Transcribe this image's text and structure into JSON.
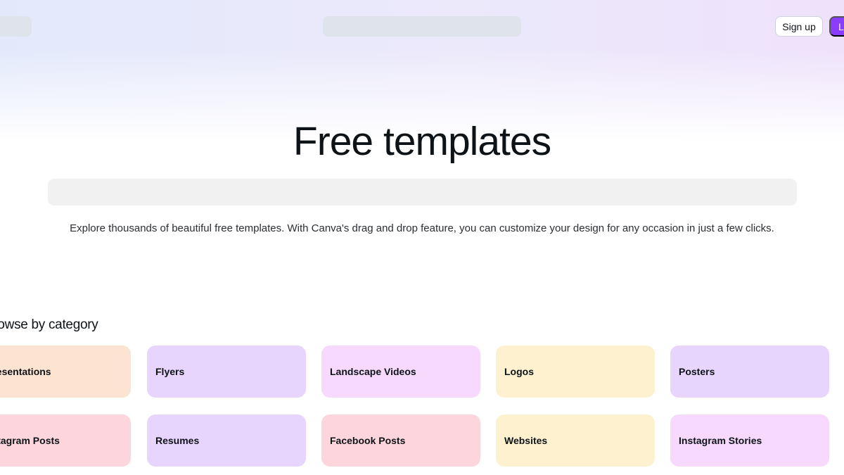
{
  "header": {
    "signup_label": "Sign up",
    "login_label": "Log in",
    "accent_color": "#8b3dff"
  },
  "hero": {
    "title": "Free templates",
    "description": "Explore thousands of beautiful free templates. With Canva's drag and drop feature, you can customize your design for any occasion in just a few clicks."
  },
  "categories": {
    "heading": "Browse by category",
    "items": [
      {
        "label": "Presentations",
        "color": "#fde3d1"
      },
      {
        "label": "Flyers",
        "color": "#e8d5fe"
      },
      {
        "label": "Landscape Videos",
        "color": "#f6d9fd"
      },
      {
        "label": "Logos",
        "color": "#fdf1cf"
      },
      {
        "label": "Posters",
        "color": "#e8d5fe"
      },
      {
        "label": "Instagram Posts",
        "color": "#fdd6dd"
      },
      {
        "label": "Resumes",
        "color": "#e8d5fe"
      },
      {
        "label": "Facebook Posts",
        "color": "#fdd6dd"
      },
      {
        "label": "Websites",
        "color": "#fdf1cf"
      },
      {
        "label": "Instagram Stories",
        "color": "#f6d9fd"
      }
    ]
  }
}
